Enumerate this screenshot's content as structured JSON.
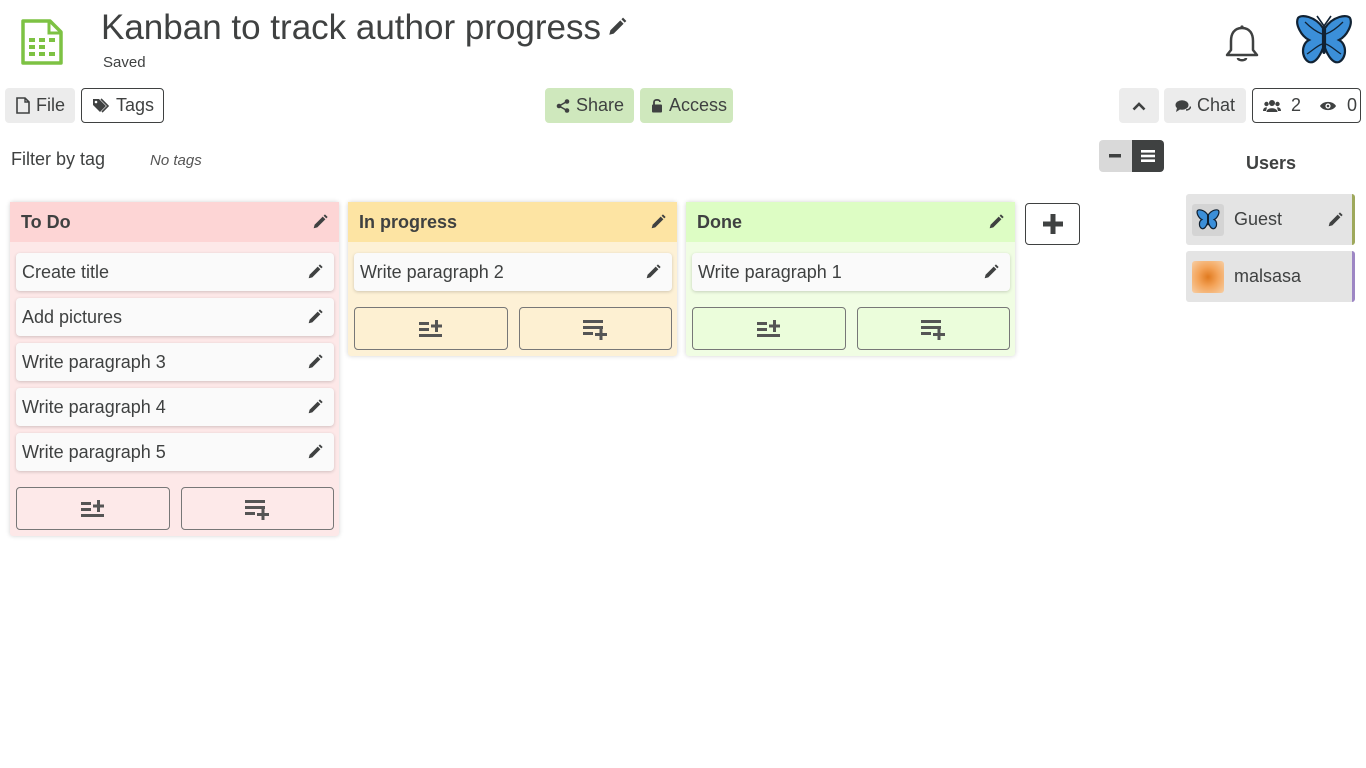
{
  "header": {
    "title": "Kanban to track author progress",
    "status": "Saved"
  },
  "toolbar": {
    "file_label": "File",
    "tags_label": "Tags",
    "share_label": "Share",
    "access_label": "Access",
    "chat_label": "Chat",
    "users_count": "2",
    "viewers_count": "0"
  },
  "filter": {
    "label": "Filter by tag",
    "empty_text": "No tags"
  },
  "boards": [
    {
      "title": "To Do",
      "items": [
        "Create title",
        "Add pictures",
        "Write paragraph 3",
        "Write paragraph 4",
        "Write paragraph 5"
      ]
    },
    {
      "title": "In progress",
      "items": [
        "Write paragraph 2"
      ]
    },
    {
      "title": "Done",
      "items": [
        "Write paragraph 1"
      ]
    }
  ],
  "users_panel": {
    "title": "Users",
    "users": [
      {
        "name": "Guest"
      },
      {
        "name": "malsasa"
      }
    ]
  },
  "colors": {
    "text": "#3f4141",
    "todo_header": "#fdd5d5",
    "progress_header": "#fde4a3",
    "done_header": "#ddfdc4",
    "share_bg": "#cfe8bd",
    "app_icon": "#7dc243",
    "butterfly": "#3b8fd9"
  },
  "icons": {
    "app": "spreadsheet-icon",
    "edit": "pencil-icon",
    "notifications": "bell-icon",
    "avatar": "butterfly-icon"
  }
}
